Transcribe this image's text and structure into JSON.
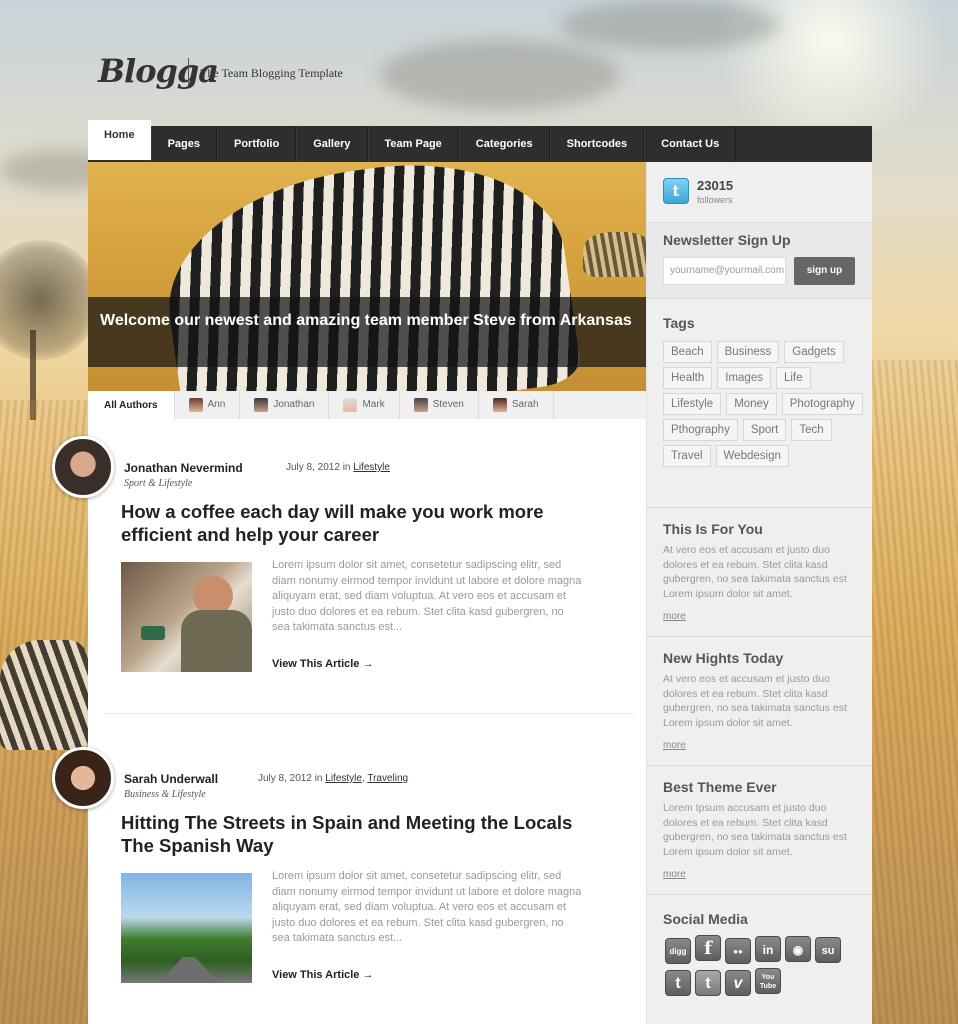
{
  "header": {
    "logo": "Blogga",
    "tagline": "The Team Blogging Template"
  },
  "nav": [
    {
      "label": "Home",
      "active": true
    },
    {
      "label": "Pages"
    },
    {
      "label": "Portfolio"
    },
    {
      "label": "Gallery"
    },
    {
      "label": "Team Page"
    },
    {
      "label": "Categories"
    },
    {
      "label": "Shortcodes"
    },
    {
      "label": "Contact Us"
    }
  ],
  "hero": {
    "caption": "Welcome our newest and amazing team member Steve from Arkansas"
  },
  "author_tabs": [
    "All Authors",
    "Ann",
    "Jonathan",
    "Mark",
    "Steven",
    "Sarah"
  ],
  "posts": [
    {
      "author": "Jonathan Nevermind",
      "role": "Sport & Lifestyle",
      "date": "July 8, 2012 in ",
      "categories": [
        "Lifestyle"
      ],
      "title": "How a coffee each day will make you work more efficient and help your career",
      "excerpt": "Lorem ipsum dolor sit amet, consetetur sadipscing elitr, sed diam nonumy eirmod tempor invidunt ut labore et dolore magna aliquyam erat, sed diam voluptua. At vero eos et accusam et justo duo dolores et ea rebum. Stet clita kasd gubergren, no sea takimata sanctus est...",
      "read_more": "View This Article →"
    },
    {
      "author": "Sarah Underwall",
      "role": "Business & Lifestyle",
      "date": "July 8, 2012 in ",
      "categories": [
        "Lifestyle",
        "Traveling"
      ],
      "title": "Hitting The Streets in Spain and Meeting the Locals The Spanish Way",
      "excerpt": "Lorem ipsum dolor sit amet, consetetur sadipscing elitr, sed diam nonumy eirmod tempor invidunt ut labore et dolore magna aliquyam erat, sed diam voluptua. At vero eos et accusam et justo duo dolores et ea rebum. Stet clita kasd gubergren, no sea takimata sanctus est...",
      "read_more": "View This Article →"
    }
  ],
  "sidebar": {
    "twitter": {
      "count": "23015",
      "label": "followers"
    },
    "newsletter": {
      "title": "Newsletter Sign Up",
      "placeholder": "yourname@yourmail.com",
      "button": "sign up"
    },
    "tags": {
      "title": "Tags",
      "items": [
        "Beach",
        "Business",
        "Gadgets",
        "Health",
        "Images",
        "Life",
        "Lifestyle",
        "Money",
        "Photography",
        "Pthography",
        "Sport",
        "Tech",
        "Travel",
        "Webdesign"
      ]
    },
    "blocks": [
      {
        "title": "This Is For You",
        "text": "At vero eos et accusam et justo duo dolores et ea rebum. Stet clita kasd gubergren, no sea takimata sanctus est Lorem ipsum dolor sit amet.",
        "more": "more"
      },
      {
        "title": "New Hights Today",
        "text": "At vero eos et accusam et justo duo dolores et ea rebum. Stet clita kasd gubergren, no sea takimata sanctus est Lorem ipsum dolor sit amet.",
        "more": "more"
      },
      {
        "title": "Best Theme Ever",
        "text": "Lorem Ipsum accusam et justo duo dolores et ea rebum. Stet clita kasd gubergren, no sea takimata sanctus est Lorem ipsum dolor sit amet.",
        "more": "more"
      }
    ],
    "social": {
      "title": "Social Media",
      "icons": [
        {
          "name": "digg-icon",
          "glyph": "digg"
        },
        {
          "name": "facebook-icon",
          "glyph": "f"
        },
        {
          "name": "flickr-icon",
          "glyph": "●●"
        },
        {
          "name": "linkedin-icon",
          "glyph": "in"
        },
        {
          "name": "rss-icon",
          "glyph": "◉"
        },
        {
          "name": "stumbleupon-icon",
          "glyph": "su"
        },
        {
          "name": "tumblr-icon",
          "glyph": "t"
        },
        {
          "name": "twitter-icon",
          "glyph": "t"
        },
        {
          "name": "vimeo-icon",
          "glyph": "v"
        },
        {
          "name": "youtube-icon",
          "glyph": "You\nTube"
        }
      ]
    }
  }
}
